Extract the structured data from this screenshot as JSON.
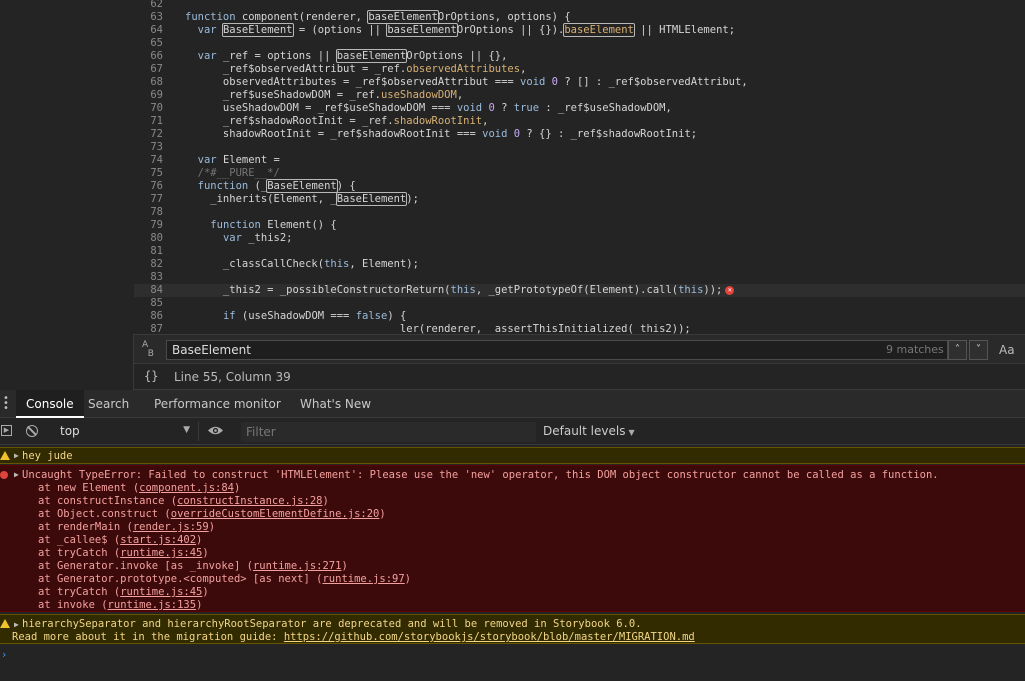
{
  "editor": {
    "lines": [
      {
        "n": "62",
        "code": ""
      },
      {
        "n": "63",
        "code": "function component(renderer, baseElementOrOptions, options) {"
      },
      {
        "n": "64",
        "code": "  var BaseElement = (options || baseElementOrOptions || {}).baseElement || HTMLElement;"
      },
      {
        "n": "65",
        "code": ""
      },
      {
        "n": "66",
        "code": "  var _ref = options || baseElementOrOptions || {},"
      },
      {
        "n": "67",
        "code": "      _ref$observedAttribut = _ref.observedAttributes,"
      },
      {
        "n": "68",
        "code": "      observedAttributes = _ref$observedAttribut === void 0 ? [] : _ref$observedAttribut,"
      },
      {
        "n": "69",
        "code": "      _ref$useShadowDOM = _ref.useShadowDOM,"
      },
      {
        "n": "70",
        "code": "      useShadowDOM = _ref$useShadowDOM === void 0 ? true : _ref$useShadowDOM,"
      },
      {
        "n": "71",
        "code": "      _ref$shadowRootInit = _ref.shadowRootInit,"
      },
      {
        "n": "72",
        "code": "      shadowRootInit = _ref$shadowRootInit === void 0 ? {} : _ref$shadowRootInit;"
      },
      {
        "n": "73",
        "code": ""
      },
      {
        "n": "74",
        "code": "  var Element ="
      },
      {
        "n": "75",
        "code": "  /*#__PURE__*/"
      },
      {
        "n": "76",
        "code": "  function (_BaseElement) {"
      },
      {
        "n": "77",
        "code": "    _inherits(Element, _BaseElement);"
      },
      {
        "n": "78",
        "code": ""
      },
      {
        "n": "79",
        "code": "    function Element() {"
      },
      {
        "n": "80",
        "code": "      var _this2;"
      },
      {
        "n": "81",
        "code": ""
      },
      {
        "n": "82",
        "code": "      _classCallCheck(this, Element);"
      },
      {
        "n": "83",
        "code": ""
      },
      {
        "n": "84",
        "code": "      _this2 = _possibleConstructorReturn(this, _getPrototypeOf(Element).call(this));"
      },
      {
        "n": "85",
        "code": ""
      },
      {
        "n": "86",
        "code": "      if (useShadowDOM === false) {"
      },
      {
        "n": "87",
        "code": "                                  ler(renderer, _assertThisInitialized(_this2));"
      }
    ]
  },
  "find": {
    "query": "BaseElement",
    "count": "9 matches",
    "prev_icon": "chevron-up-icon",
    "next_icon": "chevron-down-icon",
    "match_case_label": "Aa"
  },
  "status": {
    "braces": "{}",
    "position": "Line 55, Column 39"
  },
  "drawer": {
    "tabs": [
      "Console",
      "Search",
      "Performance monitor",
      "What's New"
    ]
  },
  "console_toolbar": {
    "context": "top",
    "filter_placeholder": "Filter",
    "levels": "Default levels"
  },
  "console": {
    "warn1": "hey jude",
    "error_title": "Uncaught TypeError: Failed to construct 'HTMLElement': Please use the 'new' operator, this DOM object constructor cannot be called as a function.",
    "stack": [
      {
        "pre": "at new Element (",
        "link": "component.js:84",
        "post": ")"
      },
      {
        "pre": "at constructInstance (",
        "link": "constructInstance.js:28",
        "post": ")"
      },
      {
        "pre": "at Object.construct (",
        "link": "overrideCustomElementDefine.js:20",
        "post": ")"
      },
      {
        "pre": "at renderMain (",
        "link": "render.js:59",
        "post": ")"
      },
      {
        "pre": "at _callee$ (",
        "link": "start.js:402",
        "post": ")"
      },
      {
        "pre": "at tryCatch (",
        "link": "runtime.js:45",
        "post": ")"
      },
      {
        "pre": "at Generator.invoke [as _invoke] (",
        "link": "runtime.js:271",
        "post": ")"
      },
      {
        "pre": "at Generator.prototype.<computed> [as next] (",
        "link": "runtime.js:97",
        "post": ")"
      },
      {
        "pre": "at tryCatch (",
        "link": "runtime.js:45",
        "post": ")"
      },
      {
        "pre": "at invoke (",
        "link": "runtime.js:135",
        "post": ")"
      }
    ],
    "warn2_line1": "hierarchySeparator and hierarchyRootSeparator are deprecated and will be removed in Storybook 6.0.",
    "warn2_line2_pre": "Read more about it in the migration guide: ",
    "warn2_link": "https://github.com/storybookjs/storybook/blob/master/MIGRATION.md",
    "prompt": "›"
  },
  "colors": {
    "error_bg": "#3d0a0b",
    "warn_bg": "#332b00",
    "accent": "#3f8ef0"
  }
}
